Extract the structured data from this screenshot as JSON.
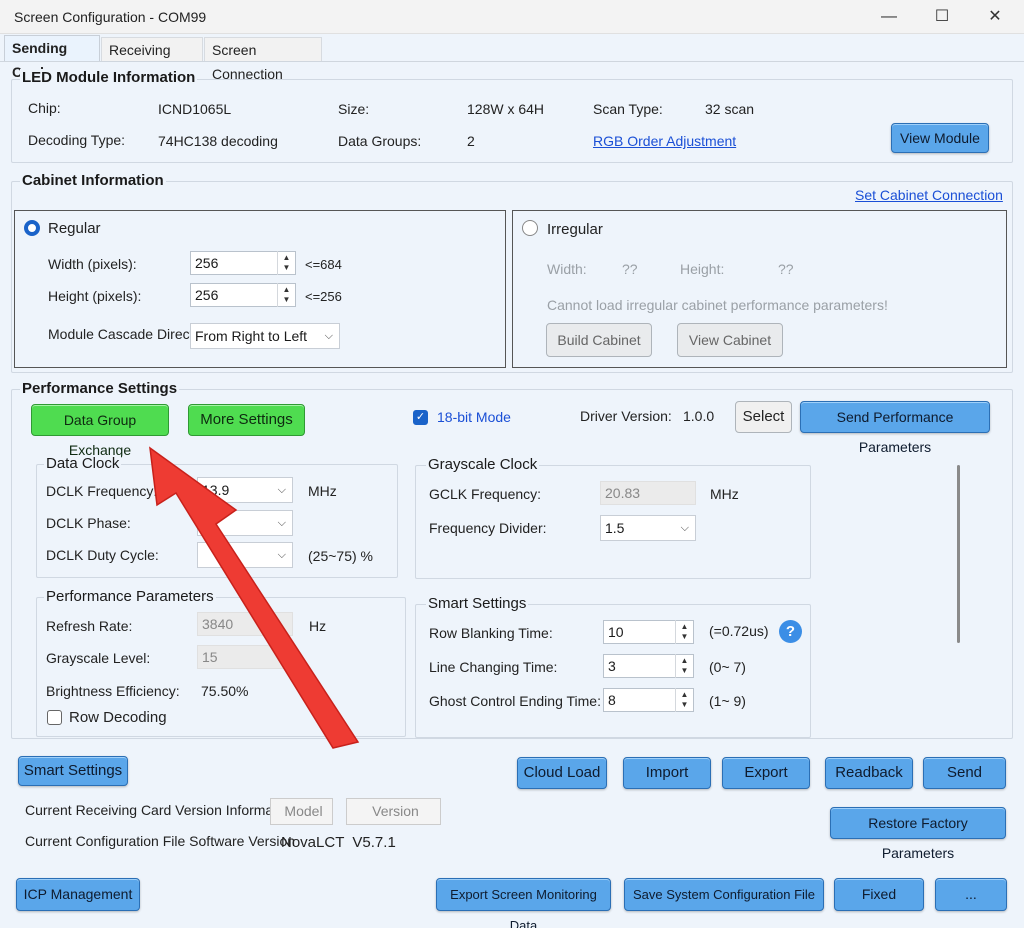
{
  "window": {
    "title": "Screen Configuration - COM99",
    "minimize": "—",
    "maximize": "☐",
    "close": "✕"
  },
  "tabs": [
    "Sending Card",
    "Receiving Card",
    "Screen Connection"
  ],
  "led_module": {
    "title": "LED Module Information",
    "chip_label": "Chip:",
    "chip_value": "ICND1065L",
    "size_label": "Size:",
    "size_value": "128W x 64H",
    "scan_label": "Scan Type:",
    "scan_value": "32 scan",
    "decoding_label": "Decoding Type:",
    "decoding_value": "74HC138 decoding",
    "groups_label": "Data Groups:",
    "groups_value": "2",
    "rgb_link": "RGB Order Adjustment",
    "view_module": "View Module"
  },
  "cabinet": {
    "title": "Cabinet Information",
    "set_link": "Set Cabinet Connection",
    "regular_label": "Regular",
    "width_label": "Width (pixels):",
    "width_value": "256",
    "width_max": "<=684",
    "height_label": "Height (pixels):",
    "height_value": "256",
    "height_max": "<=256",
    "cascade_label": "Module Cascade Direction:",
    "cascade_value": "From Right to Left",
    "irregular_label": "Irregular",
    "irr_width_label": "Width:",
    "irr_width_value": "??",
    "irr_height_label": "Height:",
    "irr_height_value": "??",
    "irr_msg": "Cannot load irregular cabinet performance parameters!",
    "build_cabinet": "Build Cabinet",
    "view_cabinet": "View Cabinet"
  },
  "performance": {
    "title": "Performance Settings",
    "data_group_exchange": "Data Group Exchange",
    "more_settings": "More Settings",
    "mode_label": "18-bit Mode",
    "driver_label": "Driver Version:",
    "driver_value": "1.0.0",
    "select": "Select",
    "send_params": "Send Performance Parameters",
    "data_clock": {
      "title": "Data Clock",
      "freq_label": "DCLK Frequency:",
      "freq_value": "13.9",
      "freq_unit": "MHz",
      "phase_label": "DCLK Phase:",
      "phase_value": "",
      "duty_label": "DCLK Duty Cycle:",
      "duty_value": "",
      "duty_range": "(25~75) %"
    },
    "grayscale_clock": {
      "title": "Grayscale Clock",
      "gclk_label": "GCLK Frequency:",
      "gclk_value": "20.83",
      "gclk_unit": "MHz",
      "divider_label": "Frequency Divider:",
      "divider_value": "1.5"
    },
    "params": {
      "title": "Performance Parameters",
      "refresh_label": "Refresh Rate:",
      "refresh_value": "3840",
      "refresh_unit": "Hz",
      "gray_label": "Grayscale Level:",
      "gray_value": "15",
      "bright_label": "Brightness Efficiency:",
      "bright_value": "75.50%",
      "row_decoding": "Row Decoding"
    },
    "smart": {
      "title": "Smart Settings",
      "blank_label": "Row Blanking Time:",
      "blank_value": "10",
      "blank_note": "(=0.72us)",
      "line_label": "Line Changing Time:",
      "line_value": "3",
      "line_note": "(0~ 7)",
      "ghost_label": "Ghost Control Ending Time:",
      "ghost_value": "8",
      "ghost_note": "(1~ 9)"
    }
  },
  "bottom": {
    "smart_settings": "Smart Settings",
    "cloud_load": "Cloud Load",
    "import": "Import",
    "export": "Export",
    "readback": "Readback",
    "send": "Send",
    "recv_version_label": "Current Receiving Card Version Information:",
    "model_ph": "Model",
    "version_ph": "Version",
    "restore": "Restore Factory Parameters",
    "config_version_label": "Current Configuration File Software Version",
    "config_version_value": "NovaLCT  V5.7.1",
    "icp": "ICP  Management",
    "export_monitor": "Export Screen Monitoring Data",
    "save_config": "Save System Configuration File",
    "fixed": "Fixed",
    "more": "..."
  },
  "annotation": {
    "color": "#ee3b33"
  }
}
